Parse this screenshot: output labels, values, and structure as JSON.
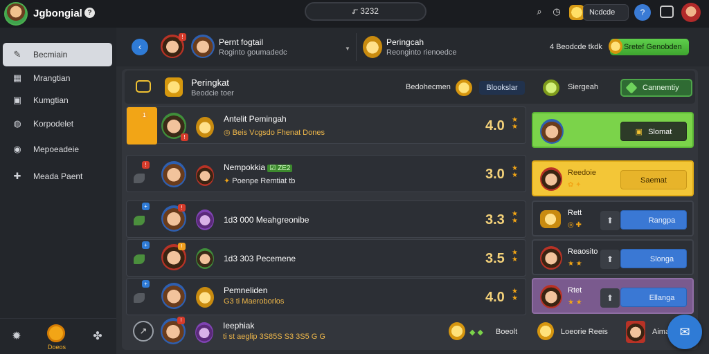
{
  "app": {
    "title": "Jgbongial",
    "title_badge": "?"
  },
  "top": {
    "search_text": "ꭊ 3232",
    "currency": "Ncdcde",
    "blue_circle": "?"
  },
  "sidebar": {
    "items": [
      {
        "label": "Becmiain",
        "icon": "puzzle-icon",
        "glyph": "✎"
      },
      {
        "label": "Mrangtian",
        "icon": "grid-icon",
        "glyph": "▦"
      },
      {
        "label": "Kumgtian",
        "icon": "calendar-icon",
        "glyph": "▣"
      },
      {
        "label": "Korpodelet",
        "icon": "globe-icon",
        "glyph": "◍"
      },
      {
        "label": "Mepoeadeie",
        "icon": "shield-icon",
        "glyph": "◉"
      },
      {
        "label": "Meada Paent",
        "icon": "puzzle-piece-icon",
        "glyph": "✚"
      }
    ],
    "bottom": {
      "left_icon": "gear-icon",
      "left_glyph": "✹",
      "center_label": "Doeos",
      "right_icon": "apps-icon",
      "right_glyph": "✤"
    }
  },
  "header": {
    "back_glyph": "‹",
    "player_name": "Pernt fogtail",
    "player_sub": "Roginto goumadedc",
    "player2_name": "Peringcah",
    "player2_sub": "Reonginto rienoedce",
    "right_text": "4 Beodcde tkdk",
    "green_pill": "Sretef Genobden"
  },
  "board": {
    "title": "Peringkat",
    "subtitle": "Beodcie toer",
    "text_a": "Bedohecmen",
    "pill": "Blookslar",
    "text_b": "Siergeah",
    "button": "Cannemtiy"
  },
  "rows": [
    {
      "name": "Antelit Pemingah",
      "sub": "Beis Vcgsdo Fhenat Dones",
      "sub_glyph": "◎",
      "score": "4.0",
      "reward_title": "",
      "button": "Slomat",
      "button_glyph": "▣"
    },
    {
      "name": "Nempokkia",
      "name_badge": "☑ ZE2",
      "sub": "Poenpe Remtiat tb",
      "sub_glyph": "✦",
      "score": "3.0",
      "reward_title": "Reedoie",
      "button": "Saemat"
    },
    {
      "line": "1d3 000 Meahgreonibe",
      "score": "3.3",
      "reward_title": "Rett",
      "button": "Rangpa"
    },
    {
      "line": "1d3 303 Pecemene",
      "score": "3.5",
      "reward_title": "Reaosito",
      "button": "Slonga"
    },
    {
      "name": "Pemneliden",
      "sub": "G3 ti Maeroborlos",
      "score": "4.0",
      "reward_title": "Rtet",
      "button": "Ellanga"
    }
  ],
  "footer": {
    "glyph": "↗",
    "name": "Ieephiak",
    "line": "ti st aeglip 3S85S S3 3S5 G G",
    "text_a": "Boeolt",
    "text_b": "Loeorie Reeis",
    "badge": "Aimak"
  },
  "chat_glyph": "✉"
}
